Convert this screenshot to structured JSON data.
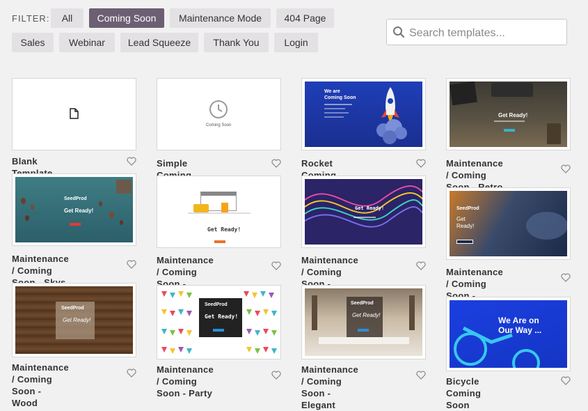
{
  "filter": {
    "label": "FILTER:",
    "buttons": [
      "All",
      "Coming Soon",
      "Maintenance Mode",
      "404 Page",
      "Sales",
      "Webinar",
      "Lead Squeeze",
      "Thank You",
      "Login"
    ],
    "active": "Coming Soon"
  },
  "search": {
    "placeholder": "Search templates..."
  },
  "templates": [
    {
      "title_lines": [
        "Blank Template"
      ]
    },
    {
      "title_lines": [
        "Simple Coming Soon Page"
      ],
      "thumb_text": "Coming Soon"
    },
    {
      "title_lines": [
        "Rocket Coming Soon Page"
      ],
      "thumb_heading": [
        "We are",
        "Coming Soon"
      ]
    },
    {
      "title_lines": [
        "Maintenance / Coming",
        "Soon - Retro Study"
      ],
      "thumb_text": "Get Ready!"
    },
    {
      "title_lines": [
        "Maintenance / Coming",
        "Soon - Skys The Limit"
      ],
      "thumb_logo": "SeedProd",
      "thumb_text": "Get Ready!"
    },
    {
      "title_lines": [
        "Maintenance / Coming",
        "Soon - Construction"
      ],
      "thumb_text": "Get Ready!"
    },
    {
      "title_lines": [
        "Maintenance / Coming",
        "Soon - Threads"
      ],
      "thumb_text": "Get Ready!"
    },
    {
      "title_lines": [
        "Maintenance / Coming",
        "Soon - Clouds"
      ],
      "thumb_logo": "SeedProd",
      "thumb_heading": [
        "Get",
        "Ready!"
      ]
    },
    {
      "title_lines": [
        "Maintenance / Coming",
        "Soon - Wood"
      ],
      "thumb_logo": "SeedProd",
      "thumb_text": "Get Ready!"
    },
    {
      "title_lines": [
        "Maintenance / Coming",
        "Soon - Party"
      ],
      "thumb_logo": "SeedProd",
      "thumb_text": "Get Ready!"
    },
    {
      "title_lines": [
        "Maintenance / Coming",
        "Soon - Elegant"
      ],
      "thumb_logo": "SeedProd",
      "thumb_text": "Get Ready!"
    },
    {
      "title_lines": [
        "Bicycle Coming Soon"
      ],
      "thumb_heading": [
        "We Are on",
        "Our Way ..."
      ]
    }
  ],
  "colors": {
    "active_filter": "#6d5f73",
    "filter_bg": "#e4e1e5",
    "page_bg": "#f1f1f1"
  },
  "icons": {
    "search": "search-icon",
    "heart": "heart-icon",
    "blank_page": "file-icon",
    "clock": "clock-icon"
  }
}
